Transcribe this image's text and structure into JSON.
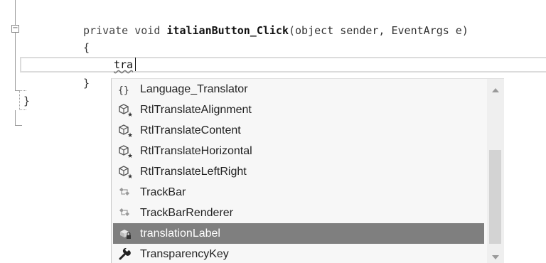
{
  "editor": {
    "method_signature": {
      "kw_private": "private",
      "kw_void": "void",
      "name": "italianButton_Click",
      "params": "(object sender, EventArgs e)"
    },
    "open_brace": "{",
    "close_brace": "}",
    "outer_close_brace": "}",
    "collapse_glyph": "−",
    "typed_text": "tra"
  },
  "completion": {
    "items": [
      {
        "label": "Language_Translator",
        "icon": "namespace-icon"
      },
      {
        "label": "RtlTranslateAlignment",
        "icon": "event-icon"
      },
      {
        "label": "RtlTranslateContent",
        "icon": "event-icon"
      },
      {
        "label": "RtlTranslateHorizontal",
        "icon": "event-icon"
      },
      {
        "label": "RtlTranslateLeftRight",
        "icon": "event-icon"
      },
      {
        "label": "TrackBar",
        "icon": "class-icon"
      },
      {
        "label": "TrackBarRenderer",
        "icon": "class-icon"
      },
      {
        "label": "translationLabel",
        "icon": "field-icon"
      },
      {
        "label": "TransparencyKey",
        "icon": "property-icon"
      }
    ],
    "selected_label": "translationLabel"
  }
}
